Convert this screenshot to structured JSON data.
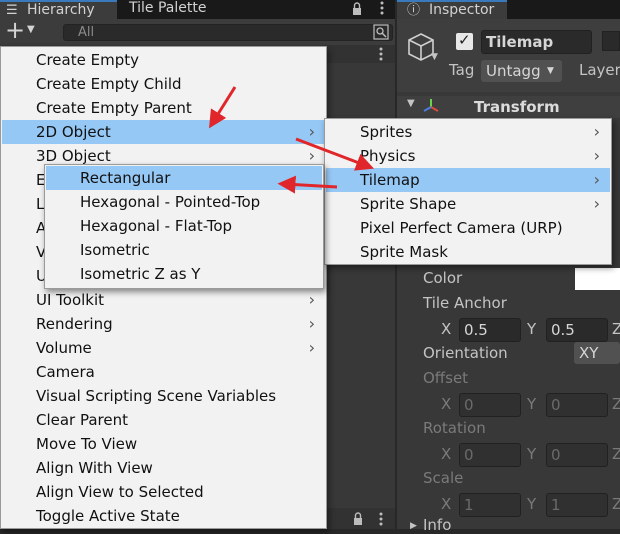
{
  "hierarchy": {
    "tab_hierarchy": "Hierarchy",
    "tab_tile_palette": "Tile Palette",
    "add_button": "+",
    "search_placeholder": "All"
  },
  "inspector": {
    "tab_label": "Inspector",
    "object_name": "Tilemap",
    "tag_label": "Tag",
    "tag_value": "Untagg",
    "layer_label": "Layer",
    "transform_title": "Transform",
    "color_label": "Color",
    "tile_anchor_label": "Tile Anchor",
    "anchor_x": "0.5",
    "anchor_y": "0.5",
    "orientation_label": "Orientation",
    "orientation_value": "XY",
    "offset_label": "Offset",
    "offset_x": "0",
    "offset_y": "0",
    "rotation_label": "Rotation",
    "rotation_x": "0",
    "rotation_y": "0",
    "scale_label": "Scale",
    "scale_x": "1",
    "scale_y": "1",
    "x_axis": "X",
    "y_axis": "Y",
    "info_label": "Info"
  },
  "main_menu": [
    {
      "label": "Create Empty"
    },
    {
      "label": "Create Empty Child"
    },
    {
      "label": "Create Empty Parent"
    },
    {
      "label": "2D Object",
      "submenu": true,
      "highlighted": true
    },
    {
      "label": "3D Object",
      "submenu": true
    },
    {
      "label": "E",
      "submenu": false
    },
    {
      "label": "L",
      "submenu": false
    },
    {
      "label": "A",
      "submenu": false
    },
    {
      "label": "V",
      "submenu": false
    },
    {
      "label": "U",
      "submenu": false
    },
    {
      "label": "UI Toolkit",
      "submenu": true
    },
    {
      "label": "Rendering",
      "submenu": true
    },
    {
      "label": "Volume",
      "submenu": true
    },
    {
      "label": "Camera"
    },
    {
      "label": "Visual Scripting Scene Variables"
    },
    {
      "label": "Clear Parent"
    },
    {
      "label": "Move To View"
    },
    {
      "label": "Align With View"
    },
    {
      "label": "Align View to Selected"
    },
    {
      "label": "Toggle Active State"
    }
  ],
  "submenu_2d": [
    {
      "label": "Sprites",
      "submenu": true
    },
    {
      "label": "Physics",
      "submenu": true
    },
    {
      "label": "Tilemap",
      "submenu": true,
      "highlighted": true
    },
    {
      "label": "Sprite Shape",
      "submenu": true
    },
    {
      "label": "Pixel Perfect Camera (URP)"
    },
    {
      "label": "Sprite Mask"
    }
  ],
  "submenu_tilemap": [
    {
      "label": "Rectangular",
      "highlighted": true
    },
    {
      "label": "Hexagonal - Pointed-Top"
    },
    {
      "label": "Hexagonal - Flat-Top"
    },
    {
      "label": "Isometric"
    },
    {
      "label": "Isometric Z as Y"
    }
  ],
  "colors": {
    "highlight": "#96c8f5",
    "annotation_arrow": "#e0262a",
    "menu_bg": "#f2f2f2",
    "panel_bg": "#383838"
  }
}
